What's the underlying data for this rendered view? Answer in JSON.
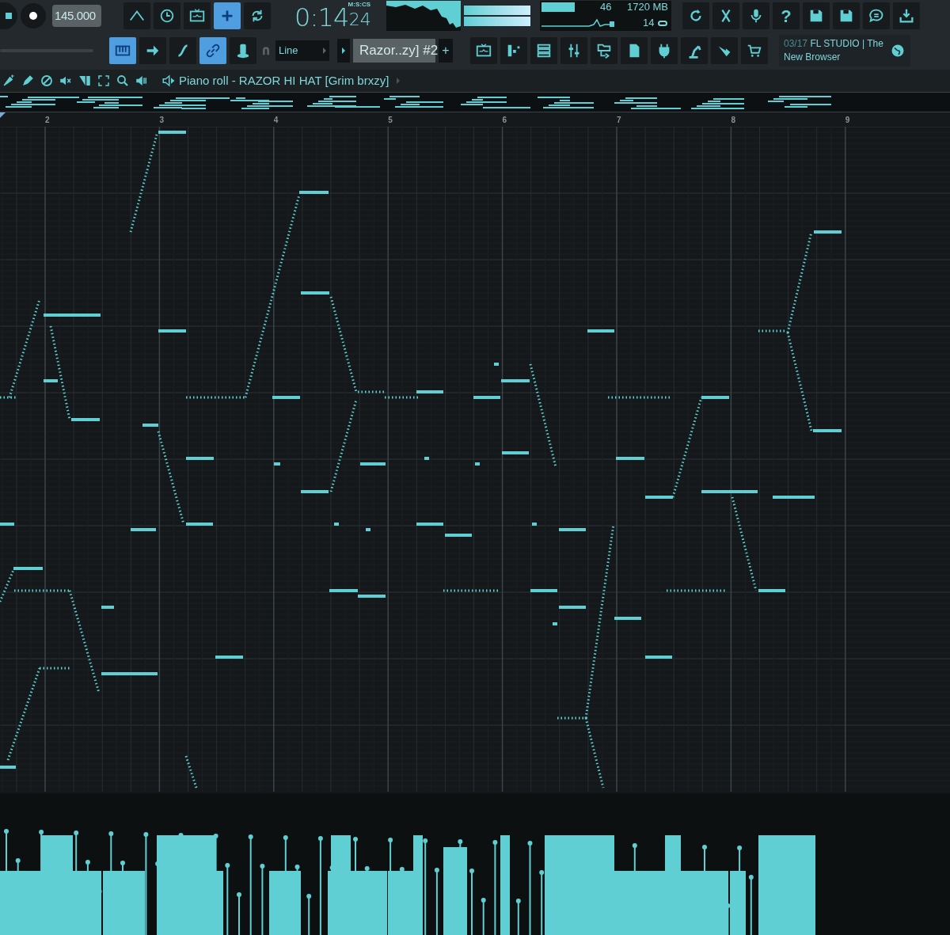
{
  "tempo": "145.000",
  "toolbar_1": [
    {
      "selected": false
    },
    {
      "selected": false
    },
    {
      "selected": false
    },
    {
      "selected": true
    },
    {
      "selected": false
    }
  ],
  "song_time": {
    "main": "0:14",
    "sub": "24",
    "unit": "M:S:CS"
  },
  "monitor": {
    "cpu": "46",
    "memory": "1720 MB",
    "polyphony": "14"
  },
  "help_button": "?",
  "toolbar_2": [
    {
      "selected": true
    },
    {
      "selected": false
    },
    {
      "selected": false
    },
    {
      "selected": true
    },
    {
      "selected": false
    }
  ],
  "snap": "Line",
  "pattern": "Razor..zy] #2",
  "add_pattern": "+",
  "hint": {
    "counter": "03/17",
    "title": "FL STUDIO | The",
    "subtitle": "New Browser"
  },
  "piano_roll": {
    "title": "Piano roll - RAZOR HI HAT [Grim brxzy]",
    "ruler": [
      "2",
      "3",
      "4",
      "5",
      "6",
      "7",
      "8",
      "9"
    ]
  }
}
